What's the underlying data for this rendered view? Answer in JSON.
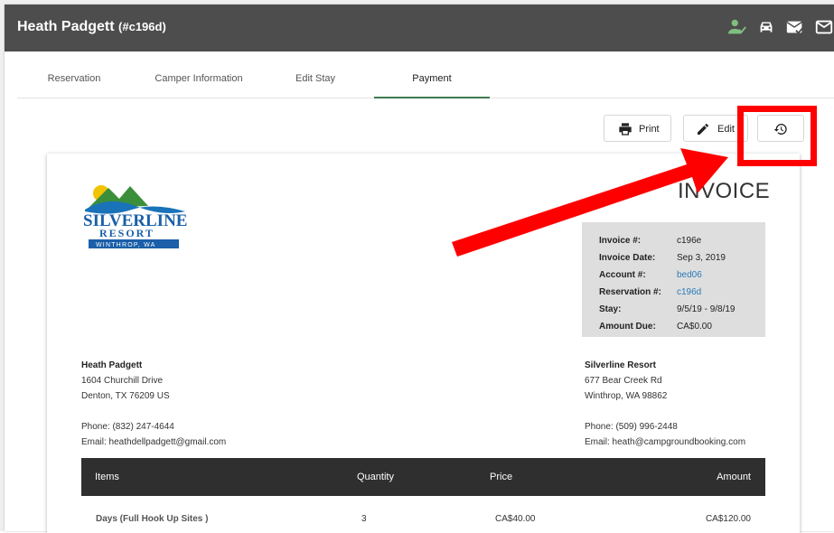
{
  "header": {
    "title": "Heath Padgett",
    "subtitle": "(#c196d)"
  },
  "tabs": [
    {
      "label": "Reservation"
    },
    {
      "label": "Camper Information"
    },
    {
      "label": "Edit Stay"
    },
    {
      "label": "Payment"
    }
  ],
  "actions": {
    "print_label": "Print",
    "edit_label": "Edit"
  },
  "invoice": {
    "title": "INVOICE",
    "logo": {
      "line1": "SILVERLINE",
      "line2": "RESORT",
      "line3": "WINTHROP, WA"
    },
    "meta": [
      {
        "key": "Invoice #:",
        "value": "c196e"
      },
      {
        "key": "Invoice Date:",
        "value": "Sep 3, 2019"
      },
      {
        "key": "Account #:",
        "value": "bed06"
      },
      {
        "key": "Reservation #:",
        "value": "c196d"
      },
      {
        "key": "Stay:",
        "value": "9/5/19 - 9/8/19"
      },
      {
        "key": "Amount Due:",
        "value": "CA$0.00"
      }
    ],
    "bill_to": {
      "name": "Heath Padgett",
      "street": "1604 Churchill Drive",
      "city": "Denton, TX 76209 US",
      "phone": "Phone: (832) 247-4644",
      "email": "Email: heathdellpadgett@gmail.com"
    },
    "from": {
      "name": "Silverline Resort",
      "street": "677 Bear Creek Rd",
      "city": "Winthrop, WA 98862",
      "phone": "Phone: (509) 996-2448",
      "email": "Email: heath@campgroundbooking.com"
    },
    "columns": {
      "items": "Items",
      "quantity": "Quantity",
      "price": "Price",
      "amount": "Amount"
    },
    "rows": [
      {
        "item": "Days (Full Hook Up Sites )",
        "quantity": "3",
        "price": "CA$40.00",
        "amount": "CA$120.00"
      }
    ]
  },
  "colors": {
    "header_bg": "#4d4d4d",
    "active_tab": "#3c7a4e",
    "link": "#2a7ab8",
    "annotation": "#ff0000",
    "table_head": "#2f2f2f"
  }
}
